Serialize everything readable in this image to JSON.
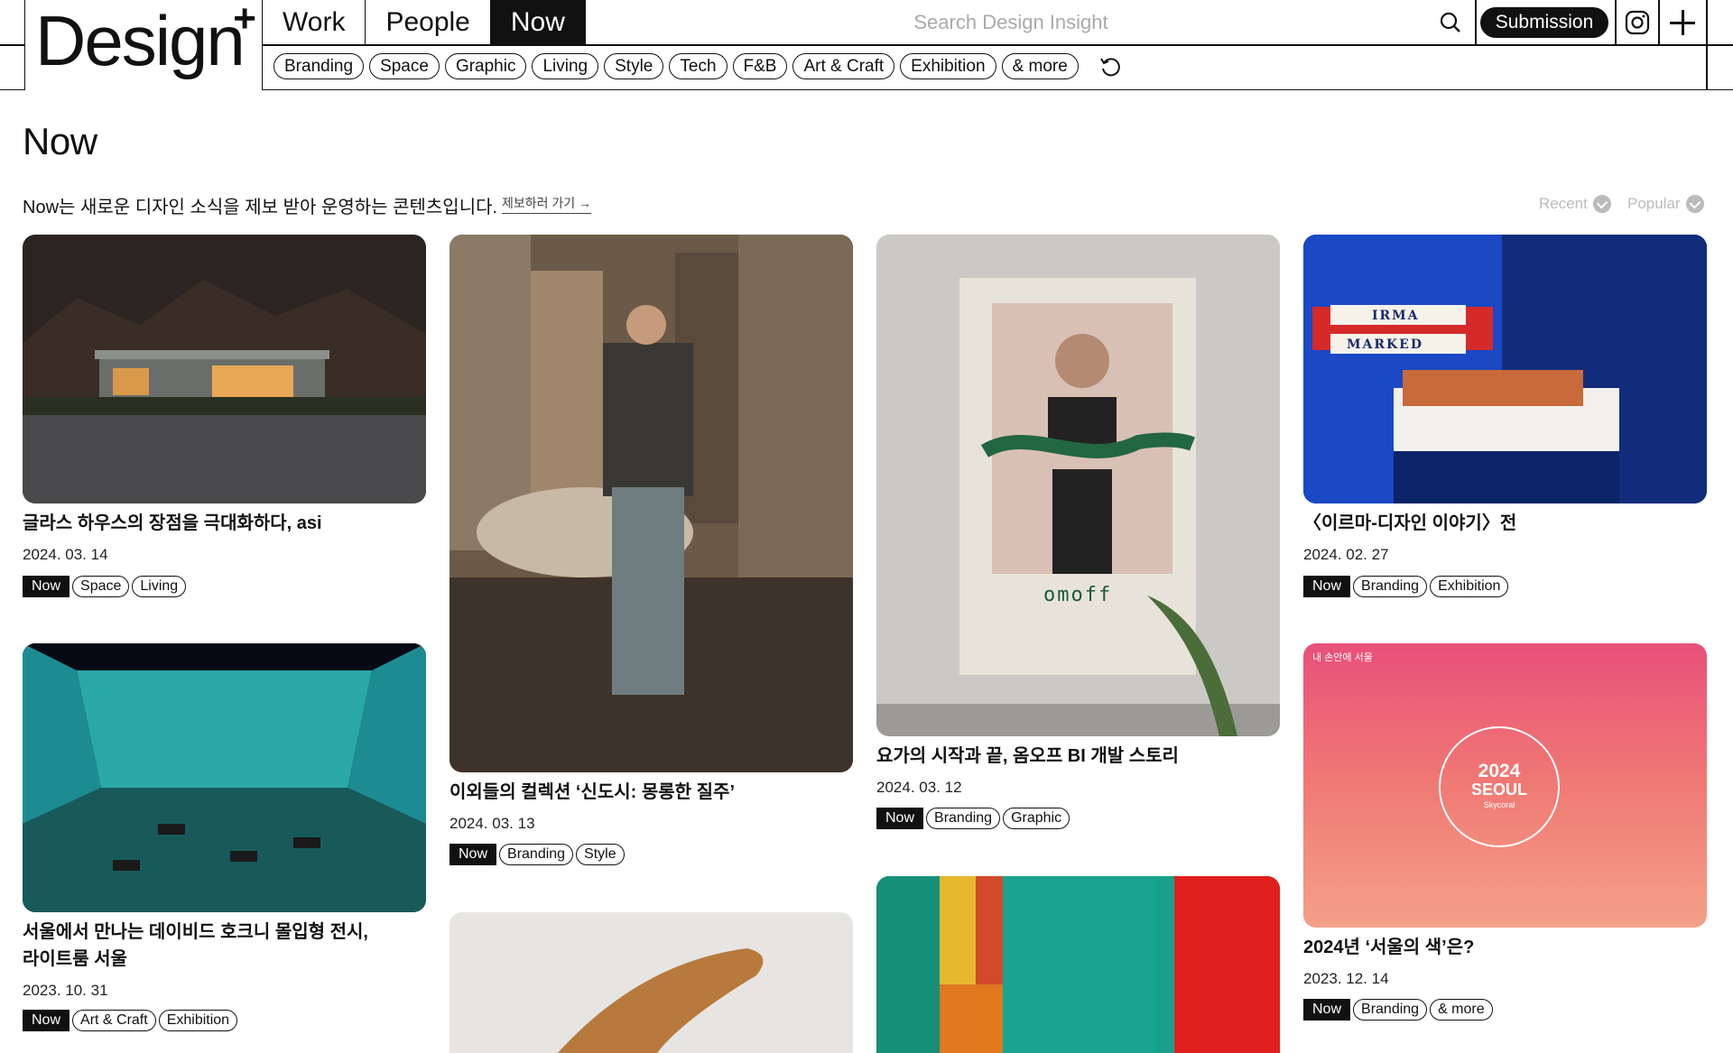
{
  "logo": {
    "text": "Design",
    "plus": "+"
  },
  "nav": [
    {
      "label": "Work"
    },
    {
      "label": "People"
    },
    {
      "label": "Now",
      "active": true
    }
  ],
  "search": {
    "placeholder": "Search Design Insight",
    "icon": "search-icon"
  },
  "submission_label": "Submission",
  "categories": [
    "Branding",
    "Space",
    "Graphic",
    "Living",
    "Style",
    "Tech",
    "F&B",
    "Art & Craft",
    "Exhibition",
    "& more"
  ],
  "page": {
    "title": "Now",
    "intro": "Now는 새로운 디자인 소식을 제보 받아 운영하는 콘텐츠입니다.",
    "intro_link": "제보하러 가기 →",
    "sort_recent": "Recent",
    "sort_popular": "Popular"
  },
  "cards": [
    {
      "title": "글라스 하우스의 장점을 극대화하다, asi",
      "date": "2024. 03. 14",
      "tags": [
        "Now",
        "Space",
        "Living"
      ]
    },
    {
      "title": "서울에서 만나는 데이비드 호크니 몰입형 전시,",
      "title2": "라이트룸 서울",
      "date": "2023. 10. 31",
      "tags": [
        "Now",
        "Art & Craft",
        "Exhibition"
      ]
    },
    {
      "title": "이외들의 컬렉션 ‘신도시: 몽롱한 질주’",
      "date": "2024. 03. 13",
      "tags": [
        "Now",
        "Branding",
        "Style"
      ]
    },
    {
      "title": "요가의 시작과 끝, 옴오프 BI 개발 스토리",
      "date": "2024. 03. 12",
      "tags": [
        "Now",
        "Branding",
        "Graphic"
      ],
      "image_text": "omoff"
    },
    {
      "title": "〈이르마-디자인 이야기〉전",
      "date": "2024. 02. 27",
      "tags": [
        "Now",
        "Branding",
        "Exhibition"
      ],
      "image_text_1": "IRMA",
      "image_text_2": "MARKED"
    },
    {
      "title": "2024년 ‘서울의 색’은?",
      "date": "2023. 12. 14",
      "tags": [
        "Now",
        "Branding",
        "& more"
      ],
      "image_badge": "내 손안에 서울",
      "image_text_1": "2024",
      "image_text_2": "SEOUL",
      "image_text_3": "Skycoral"
    }
  ],
  "colors": {
    "ink": "#111111",
    "muted": "#bbbbbb",
    "bg": "#ffffff"
  }
}
